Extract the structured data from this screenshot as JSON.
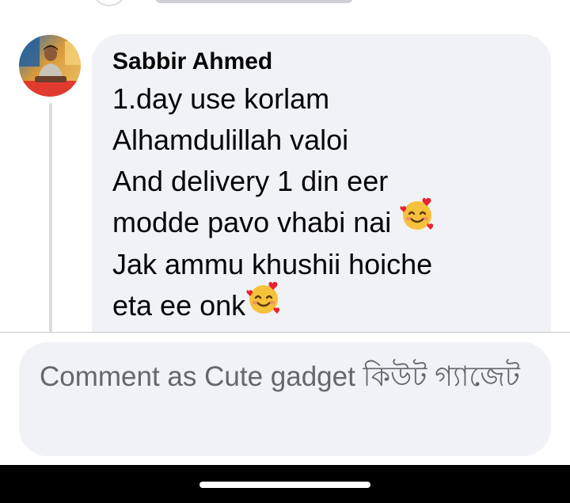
{
  "comment": {
    "author": "Sabbir Ahmed",
    "lines": [
      "1.day use korlam",
      "Alhamdulillah valoi",
      "And delivery 1 din eer",
      "modde pavo vhabi nai ",
      "Jak ammu khushii hoiche",
      "eta ee onk"
    ],
    "emoji": "smiling-face-with-hearts"
  },
  "composer": {
    "placeholder": "Comment as Cute gadget কিউট গ্যাজেট"
  },
  "colors": {
    "bubble": "#f0f2f5",
    "text": "#050505",
    "placeholder": "#65676b",
    "nav": "#000000"
  }
}
